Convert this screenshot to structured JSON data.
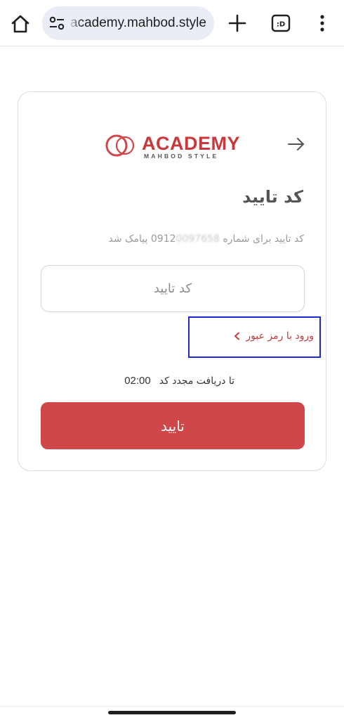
{
  "browser": {
    "url": "academy.mahbod.style",
    "tab_count": ":D"
  },
  "logo": {
    "text": "ACADEMY",
    "subtext": "MAHBOD STYLE"
  },
  "card": {
    "title": "کد تایید",
    "subtitle_prefix": "کد تایید برای شماره",
    "phone_visible": "0912",
    "phone_hidden": "0097658",
    "subtitle_suffix": "پیامک شد",
    "input_placeholder": "کد تایید",
    "password_login_link": "ورود با رمز عبور",
    "resend_timer": "02:00",
    "resend_text": "تا دریافت مجدد کد",
    "confirm_button": "تایید"
  },
  "colors": {
    "accent": "#d0474a",
    "link": "#c23b3b",
    "highlight_box": "#1c2bd1"
  }
}
